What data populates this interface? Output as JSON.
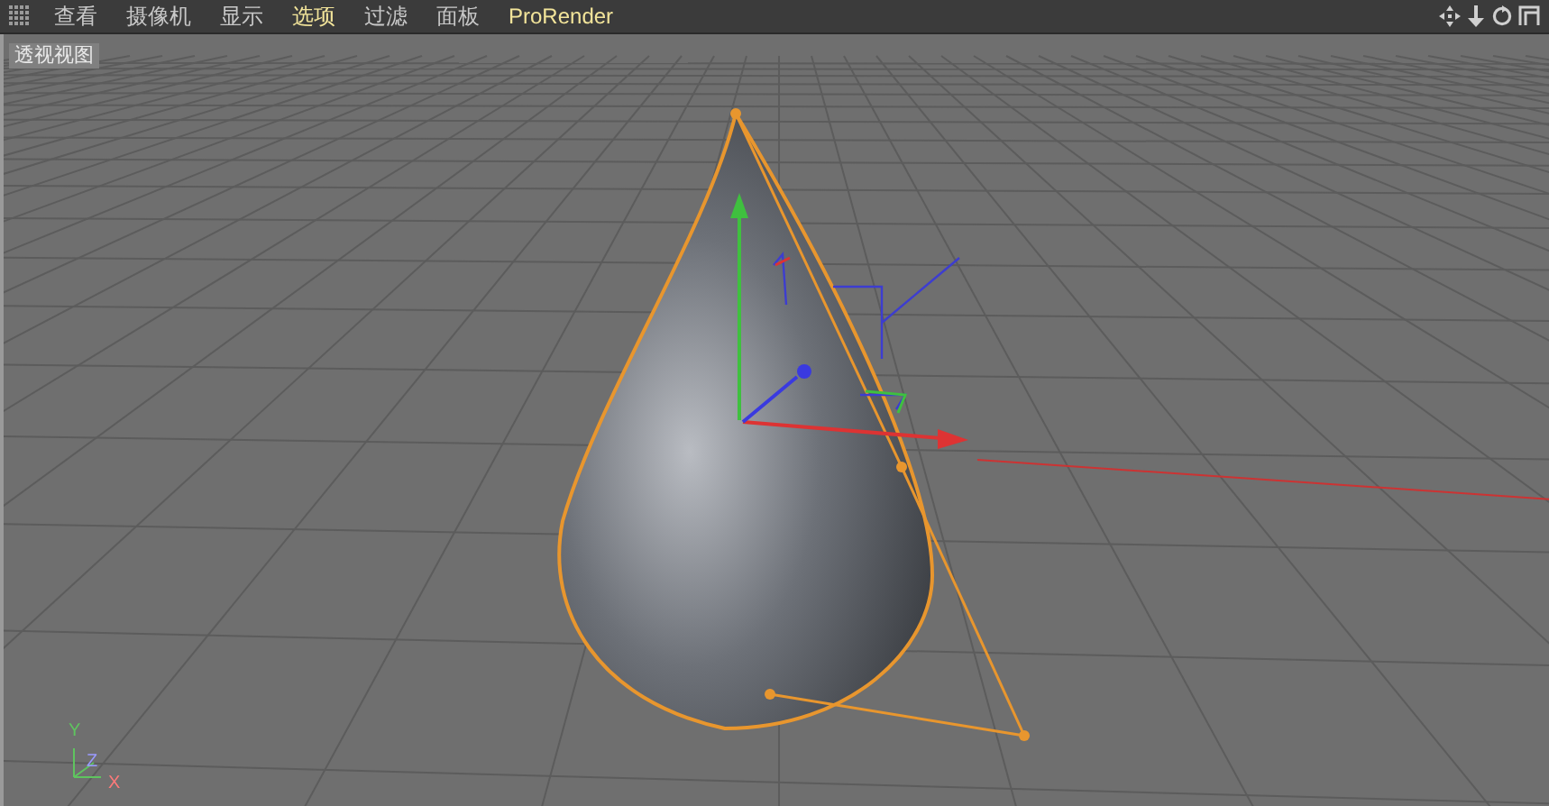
{
  "menu_bar": {
    "items": [
      {
        "label": "查看",
        "highlighted": false
      },
      {
        "label": "摄像机",
        "highlighted": false
      },
      {
        "label": "显示",
        "highlighted": false
      },
      {
        "label": "选项",
        "highlighted": true
      },
      {
        "label": "过滤",
        "highlighted": false
      },
      {
        "label": "面板",
        "highlighted": false
      },
      {
        "label": "ProRender",
        "highlighted": true
      }
    ]
  },
  "viewport": {
    "title": "透视视图",
    "axis_labels": [
      {
        "label": "Y",
        "color": "#5fc45f"
      },
      {
        "label": "Z",
        "color": "#9a9aff"
      },
      {
        "label": "X",
        "color": "#ff7a7a"
      }
    ]
  }
}
